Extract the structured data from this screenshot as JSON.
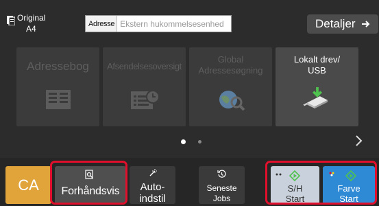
{
  "header": {
    "original_label": "Original",
    "original_value": "A4",
    "address_label": "Adresse",
    "address_placeholder": "Ekstern hukommelsesenhed",
    "details_label": "Detaljer",
    "details_icon": "arrow-right-icon"
  },
  "tiles": [
    {
      "label": "Adressebog",
      "icon": "address-book-icon",
      "active": false
    },
    {
      "label": "Afsendelsesoversigt",
      "icon": "send-history-icon",
      "active": false
    },
    {
      "label_line1": "Global",
      "label_line2": "Adressesøgning",
      "icon": "global-search-icon",
      "active": false
    },
    {
      "label_line1": "Lokalt drev/",
      "label_line2": "USB",
      "icon": "usb-drive-icon",
      "active": true
    }
  ],
  "pager": {
    "pages": 2,
    "current": 1,
    "next_icon": "chevron-right-icon"
  },
  "bottom": {
    "ca_label": "CA",
    "preview_label": "Forhåndsvis",
    "preview_icon": "preview-icon",
    "auto_line1": "Auto-",
    "auto_line2": "indstil",
    "auto_icon": "auto-set-icon",
    "recent_line1": "Seneste",
    "recent_line2": "Jobs",
    "recent_icon": "history-icon",
    "bw_line1": "S/H",
    "bw_line2": "Start",
    "color_line1": "Farve",
    "color_line2": "Start"
  },
  "colors": {
    "background": "#2c2c2c",
    "ca_orange": "#e0a43a",
    "bw_start": "#c9d1dc",
    "color_start": "#2f8ad6",
    "highlight_red": "#e0102c",
    "start_green": "#4fc24f"
  }
}
